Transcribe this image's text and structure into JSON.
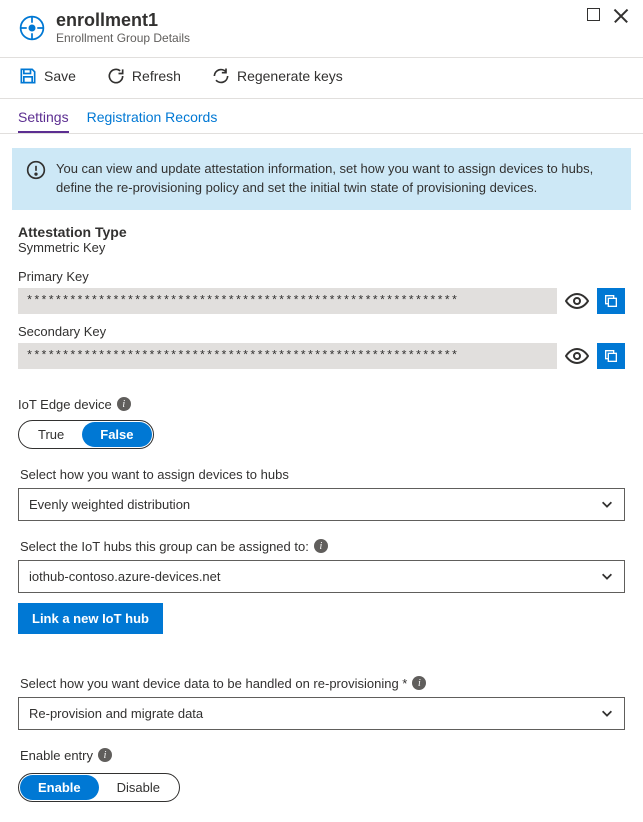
{
  "header": {
    "title": "enrollment1",
    "subtitle": "Enrollment Group Details"
  },
  "toolbar": {
    "save": "Save",
    "refresh": "Refresh",
    "regenerate": "Regenerate keys"
  },
  "tabs": {
    "settings": "Settings",
    "records": "Registration Records"
  },
  "banner": "You can view and update attestation information, set how you want to assign devices to hubs, define the re-provisioning policy and set the initial twin state of provisioning devices.",
  "attestation": {
    "label": "Attestation Type",
    "value": "Symmetric Key"
  },
  "keys": {
    "primary_label": "Primary Key",
    "primary_value": "************************************************************",
    "secondary_label": "Secondary Key",
    "secondary_value": "************************************************************"
  },
  "iot_edge": {
    "label": "IoT Edge device",
    "true": "True",
    "false": "False"
  },
  "assign": {
    "label": "Select how you want to assign devices to hubs",
    "value": "Evenly weighted distribution"
  },
  "hubs": {
    "label": "Select the IoT hubs this group can be assigned to:",
    "value": "iothub-contoso.azure-devices.net",
    "link_btn": "Link a new IoT hub"
  },
  "reprov": {
    "label": "Select how you want device data to be handled on re-provisioning *",
    "value": "Re-provision and migrate data"
  },
  "enable_entry": {
    "label": "Enable entry",
    "enable": "Enable",
    "disable": "Disable"
  }
}
